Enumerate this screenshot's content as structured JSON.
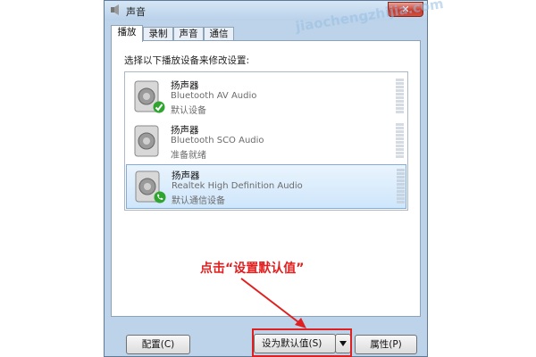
{
  "window": {
    "title": "声音",
    "close_glyph": "✕"
  },
  "tabs": [
    {
      "label": "播放",
      "active": true
    },
    {
      "label": "录制",
      "active": false
    },
    {
      "label": "声音",
      "active": false
    },
    {
      "label": "通信",
      "active": false
    }
  ],
  "instruction": "选择以下播放设备来修改设置:",
  "devices": [
    {
      "name": "扬声器",
      "driver": "Bluetooth AV Audio",
      "status": "默认设备",
      "badge": "check",
      "selected": false
    },
    {
      "name": "扬声器",
      "driver": "Bluetooth SCO Audio",
      "status": "准备就绪",
      "badge": "none",
      "selected": false
    },
    {
      "name": "扬声器",
      "driver": "Realtek High Definition Audio",
      "status": "默认通信设备",
      "badge": "phone",
      "selected": true
    }
  ],
  "annotation": "点击“设置默认值”",
  "buttons": {
    "configure": "配置(C)",
    "set_default": "设为默认值(S)",
    "properties": "属性(P)"
  },
  "watermark": "jiaochengzhijia.com",
  "colors": {
    "annotation_red": "#e02020",
    "check_green": "#2fa52f",
    "selection_blue": "#cfe6fb"
  },
  "icons": {
    "device": "speaker-icon",
    "default_badge": "green-check-icon",
    "comm_badge": "green-phone-icon",
    "meter": "level-meter-icon"
  }
}
